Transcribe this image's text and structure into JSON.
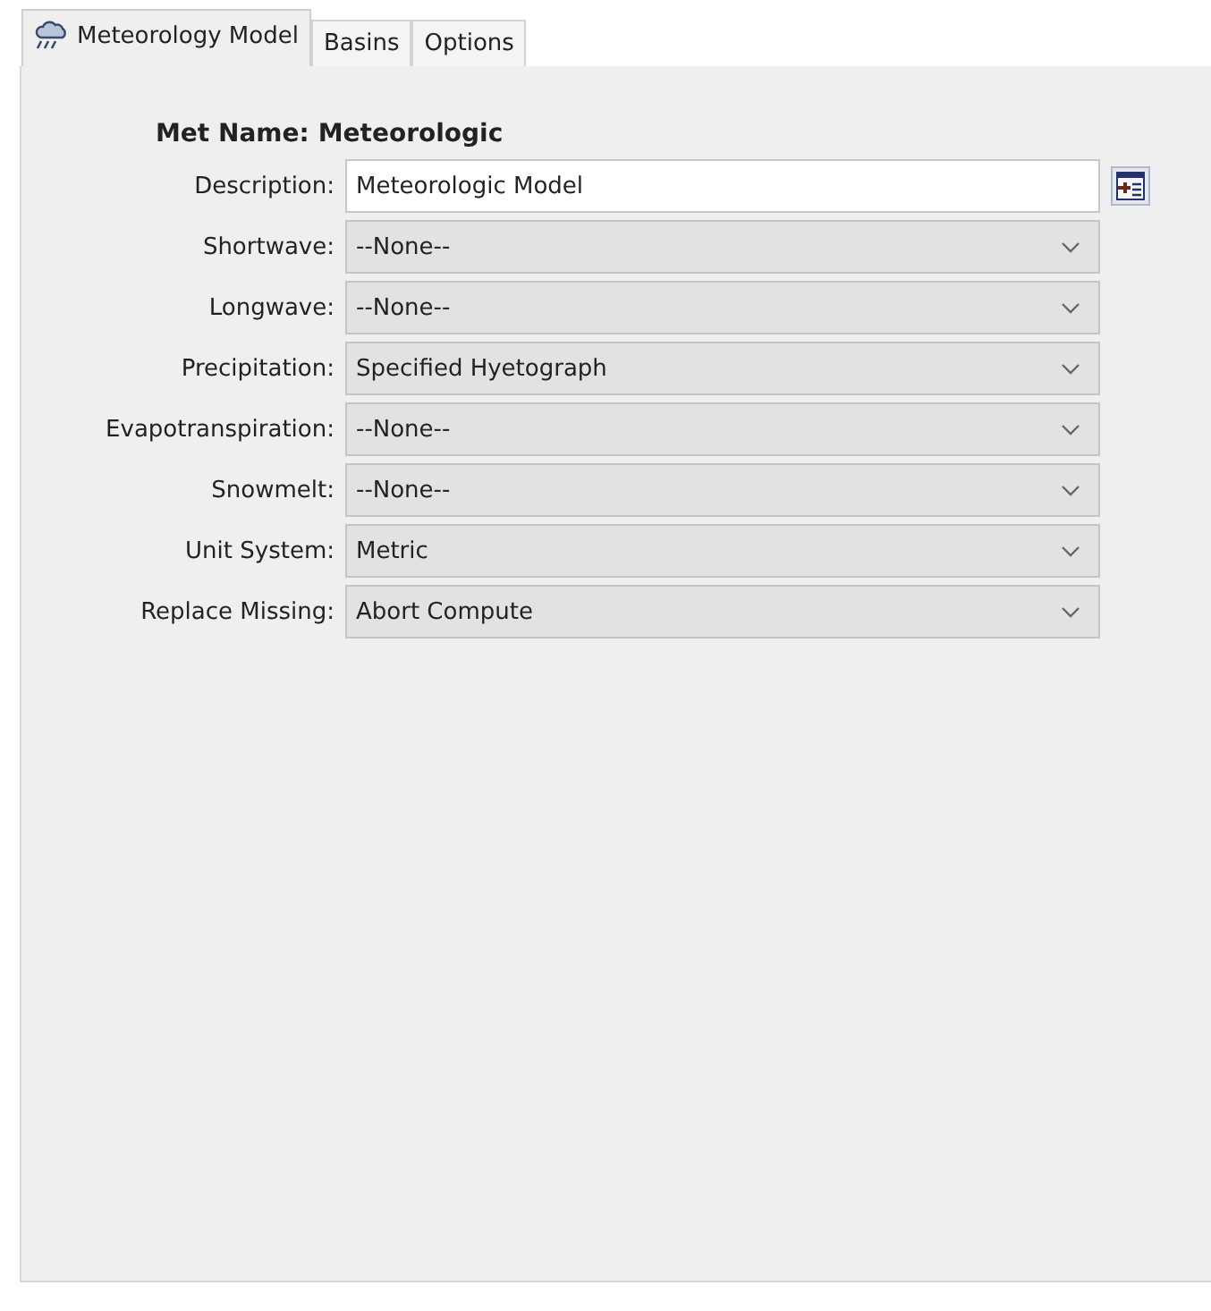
{
  "tabs": [
    {
      "label": "Meteorology Model",
      "selected": true,
      "icon": true
    },
    {
      "label": "Basins",
      "selected": false
    },
    {
      "label": "Options",
      "selected": false
    }
  ],
  "met_name": {
    "label": "Met Name:",
    "value": "Meteorologic"
  },
  "fields": [
    {
      "label": "Description:",
      "kind": "text",
      "value": "Meteorologic Model"
    },
    {
      "label": "Shortwave:",
      "kind": "dropdown",
      "value": "--None--"
    },
    {
      "label": "Longwave:",
      "kind": "dropdown",
      "value": "--None--"
    },
    {
      "label": "Precipitation:",
      "kind": "dropdown",
      "value": "Specified Hyetograph"
    },
    {
      "label": "Evapotranspiration:",
      "kind": "dropdown",
      "value": "--None--"
    },
    {
      "label": "Snowmelt:",
      "kind": "dropdown",
      "value": "--None--"
    },
    {
      "label": "Unit System:",
      "kind": "dropdown",
      "value": "Metric"
    },
    {
      "label": "Replace Missing:",
      "kind": "dropdown",
      "value": "Abort Compute"
    }
  ]
}
